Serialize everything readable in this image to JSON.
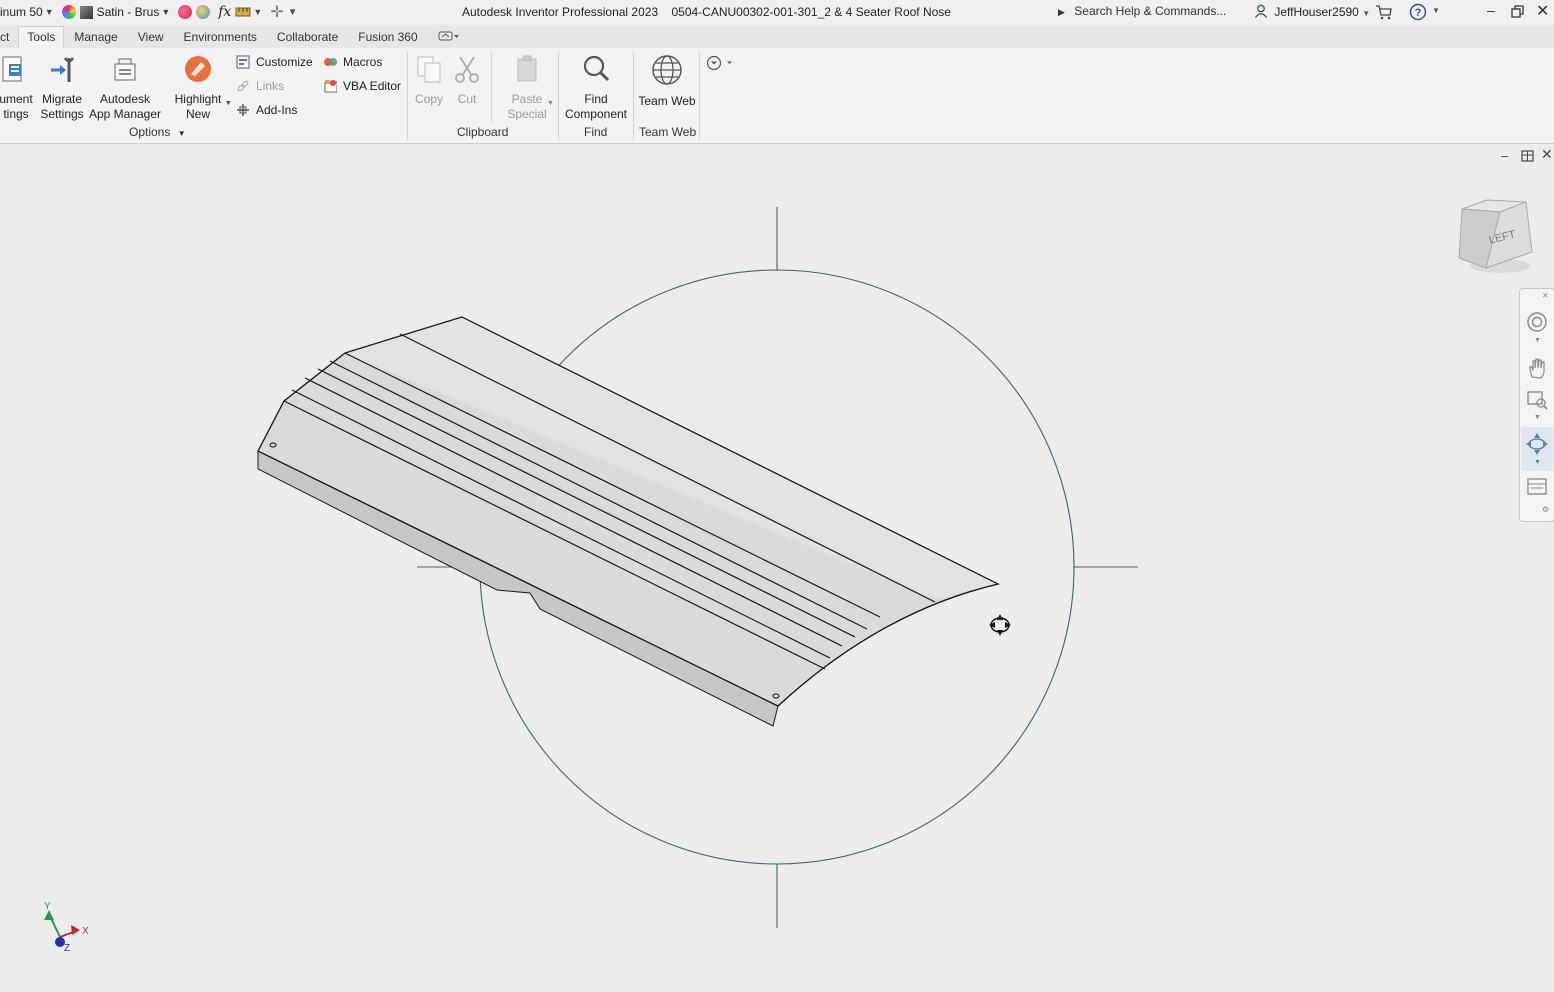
{
  "titlebar": {
    "qat_material": "inum 50",
    "qat_appearance": "Satin - Brus",
    "qat_fx": "fx",
    "app_title": "Autodesk Inventor Professional 2023",
    "doc_title": "0504-CANU00302-001-301_2 & 4 Seater Roof Nose",
    "search_placeholder": "Search Help & Commands...",
    "user": "JeffHouser2590"
  },
  "tabs": [
    {
      "label": "ct"
    },
    {
      "label": "Tools"
    },
    {
      "label": "Manage"
    },
    {
      "label": "View"
    },
    {
      "label": "Environments"
    },
    {
      "label": "Collaborate"
    },
    {
      "label": "Fusion 360"
    }
  ],
  "ribbon": {
    "options": {
      "doc_settings_l1": "ument",
      "doc_settings_l2": "tings",
      "migrate_l1": "Migrate",
      "migrate_l2": "Settings",
      "appmgr_l1": "Autodesk",
      "appmgr_l2": "App Manager",
      "highlight_l1": "Highlight",
      "highlight_l2": "New",
      "customize": "Customize",
      "links": "Links",
      "addins": "Add-Ins",
      "macros": "Macros",
      "vba": "VBA Editor",
      "label": "Options"
    },
    "clipboard": {
      "copy": "Copy",
      "cut": "Cut",
      "paste_l1": "Paste",
      "paste_l2": "Special",
      "label": "Clipboard"
    },
    "find": {
      "btn_l1": "Find",
      "btn_l2": "Component",
      "label": "Find"
    },
    "teamweb": {
      "btn": "Team Web",
      "label": "Team Web"
    }
  },
  "viewcube": {
    "face": "LEFT"
  },
  "triad": {
    "x": "X",
    "y": "Y",
    "z": "Z"
  },
  "colors": {
    "orbit_circle": "#2f6b70",
    "part_face": "#d8d8d8",
    "part_edge": "#1a1a1a",
    "axis_x": "#c0282d",
    "axis_y": "#2c9a3a",
    "axis_z": "#2233aa"
  }
}
